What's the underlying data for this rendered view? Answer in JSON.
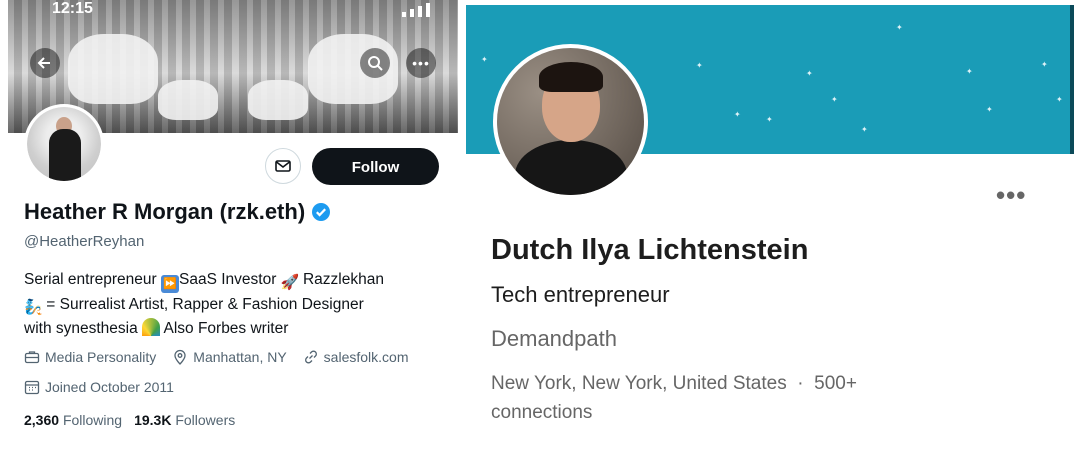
{
  "left_profile": {
    "status_time": "12:15",
    "display_name": "Heather R Morgan (rzk.eth)",
    "handle": "@HeatherReyhan",
    "follow_label": "Follow",
    "bio_parts": [
      "Serial entrepreneur ",
      "SaaS Investor ",
      " Razzlekhan",
      " = Surrealist Artist, Rapper & Fashion Designer",
      "with synesthesia ",
      " Also Forbes writer"
    ],
    "meta": {
      "category": "Media Personality",
      "location": "Manhattan, NY",
      "website": "salesfolk.com",
      "joined": "Joined October 2011"
    },
    "counts": {
      "following_value": "2,360",
      "following_label": "Following",
      "followers_value": "19.3K",
      "followers_label": "Followers"
    },
    "icons": [
      "back-arrow-icon",
      "search-icon",
      "more-icon",
      "mail-icon",
      "verified-badge-icon",
      "briefcase-icon",
      "location-pin-icon",
      "link-icon",
      "calendar-icon"
    ],
    "colors": {
      "verified": "#1d9bf0",
      "follow_bg": "#0f1419"
    }
  },
  "right_profile": {
    "name": "Dutch Ilya Lichtenstein",
    "headline": "Tech entrepreneur",
    "company": "Demandpath",
    "location": "New York, New York, United States",
    "separator": "·",
    "connections": "500+",
    "connections_suffix": "connections",
    "more_label": "•••",
    "colors": {
      "banner": "#1a9cb7"
    }
  }
}
